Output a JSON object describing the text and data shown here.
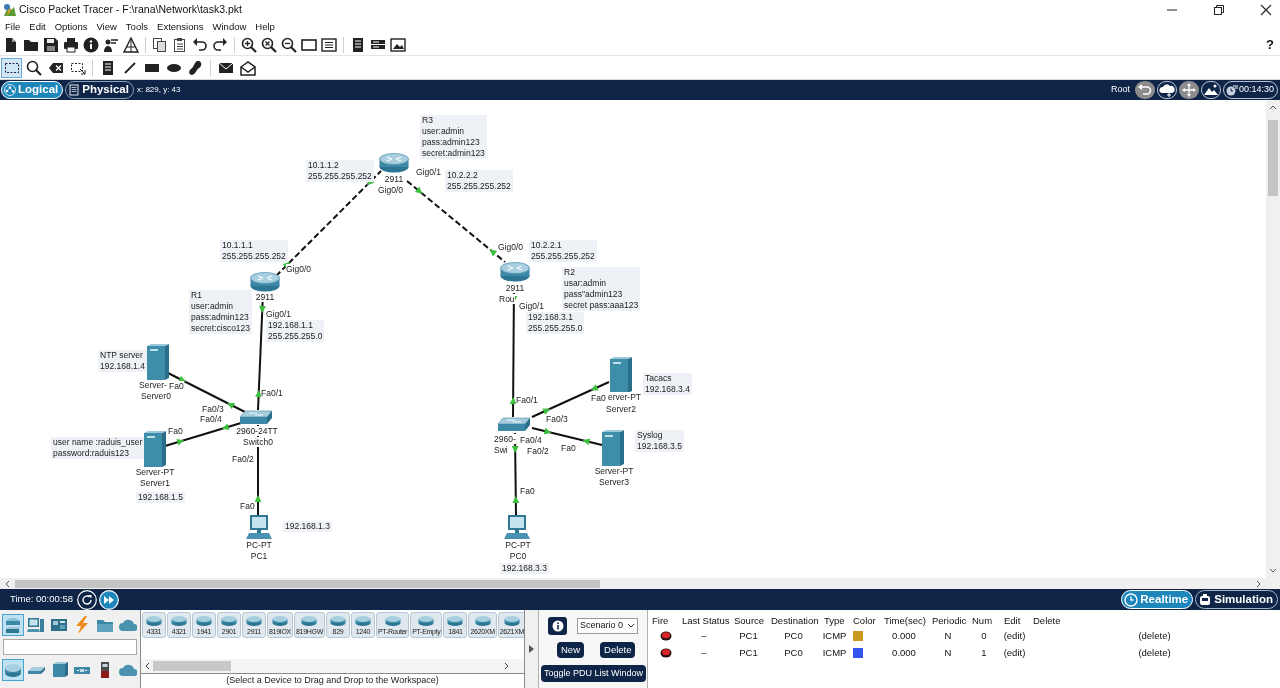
{
  "window": {
    "title": "Cisco Packet Tracer - F:\\rana\\Network\\task3.pkt"
  },
  "menu": [
    "File",
    "Edit",
    "Options",
    "View",
    "Tools",
    "Extensions",
    "Window",
    "Help"
  ],
  "help_button": "?",
  "edit_tools": [
    {
      "selected": true
    },
    {
      "selected": false
    },
    {
      "selected": false
    },
    {
      "selected": false
    },
    {
      "selected": false
    },
    {
      "selected": false
    },
    {
      "selected": false
    },
    {
      "selected": false
    },
    {
      "selected": false
    },
    {
      "selected": false
    },
    {
      "selected": false
    }
  ],
  "view_bar": {
    "tabs": [
      {
        "label": "Logical",
        "selected": true
      },
      {
        "label": "Physical",
        "selected": false
      }
    ],
    "pointer": "x: 829, y: 43",
    "location": "Root",
    "clock": "00:14:30"
  },
  "workspace": {
    "notes": [
      {
        "lines": [
          "R3",
          "user:admin",
          "pass:admin123",
          "secret:admin123"
        ]
      },
      {
        "lines": [
          "10.1.1.2",
          "255.255.255.252"
        ]
      },
      {
        "lines": [
          "10.2.2.2",
          "255.255.255.252"
        ]
      },
      {
        "lines": [
          "10.1.1.1",
          "255.255.255.252"
        ]
      },
      {
        "lines": [
          "10.2.2.1",
          "255.255.255.252"
        ]
      },
      {
        "lines": [
          "R2",
          "usar:admin",
          "pass\"admin123",
          "secret pass:aaa123"
        ]
      },
      {
        "lines": [
          "R1",
          "user:admin",
          "pass:admin123",
          "secret:cisco123"
        ]
      },
      {
        "lines": [
          "192.168.3.1",
          "255.255.255.0"
        ]
      },
      {
        "lines": [
          "192.168.1.1",
          "255.255.255.0"
        ]
      },
      {
        "lines": [
          "NTP server",
          "192.168.1.4"
        ]
      },
      {
        "lines": [
          "Tacacs",
          "192.168.3.4"
        ]
      },
      {
        "lines": [
          "Syslog",
          "192.168.3.5"
        ]
      },
      {
        "lines": [
          "user name :raduis_user",
          "password:raduis123"
        ]
      },
      {
        "lines": [
          "192.168.1.5"
        ]
      },
      {
        "lines": [
          "192.168.1.3"
        ]
      },
      {
        "lines": [
          "192.168.3.3"
        ]
      }
    ],
    "devices": [
      {
        "kind": "router",
        "labels": [
          "2911"
        ]
      },
      {
        "kind": "router",
        "labels": [
          "2911"
        ]
      },
      {
        "kind": "router",
        "labels": [
          "2911",
          "Rou"
        ]
      },
      {
        "kind": "switch",
        "labels": [
          "2960-24TT",
          "Switch0"
        ]
      },
      {
        "kind": "switch",
        "labels": [
          "2960-",
          "Swi"
        ]
      },
      {
        "kind": "server",
        "labels": [
          "Server-",
          "Server0"
        ]
      },
      {
        "kind": "server",
        "labels": [
          "Server-PT",
          "Server1"
        ]
      },
      {
        "kind": "server",
        "labels": [
          "erver-PT",
          "Server2"
        ]
      },
      {
        "kind": "server",
        "labels": [
          "Server-PT",
          "Server3"
        ]
      },
      {
        "kind": "pc",
        "labels": [
          "PC-PT",
          "PC1"
        ]
      },
      {
        "kind": "pc",
        "labels": [
          "PC-PT",
          "PC0"
        ]
      }
    ],
    "links": [
      {
        "kind": "crossover",
        "ports": [
          "Gig0/0",
          "Gig0/0"
        ]
      },
      {
        "kind": "crossover",
        "ports": [
          "Gig0/1",
          "Gig0/0"
        ]
      },
      {
        "kind": "straight",
        "ports": [
          "Gig0/1",
          "Fa0/1"
        ]
      },
      {
        "kind": "straight",
        "ports": [
          "Fa0",
          "Fa0/3"
        ]
      },
      {
        "kind": "straight",
        "ports": [
          "Fa0/4",
          "Fa0"
        ]
      },
      {
        "kind": "straight",
        "ports": [
          "Fa0/2",
          "Fa0"
        ]
      },
      {
        "kind": "straight",
        "ports": [
          "Gig0/1",
          "Fa0/1"
        ]
      },
      {
        "kind": "straight",
        "ports": [
          "Fa0",
          "Fa0/3"
        ]
      },
      {
        "kind": "straight",
        "ports": [
          "Fa0/4",
          "Fa0"
        ]
      },
      {
        "kind": "straight",
        "ports": [
          "Fa0/2",
          "Fa0"
        ]
      }
    ]
  },
  "time_bar": {
    "time": "Time: 00:00:58",
    "modes": [
      {
        "label": "Realtime",
        "selected": true
      },
      {
        "label": "Simulation",
        "selected": false
      }
    ]
  },
  "device_palette": {
    "categories": [
      {
        "selected": true
      },
      {
        "selected": false
      },
      {
        "selected": false
      },
      {
        "selected": false
      },
      {
        "selected": false
      },
      {
        "selected": false
      }
    ],
    "types": [
      {
        "selected": true
      },
      {
        "selected": false
      },
      {
        "selected": false
      },
      {
        "selected": false
      },
      {
        "selected": false
      },
      {
        "selected": false
      }
    ],
    "models": [
      "4331",
      "4321",
      "1941",
      "2901",
      "2911",
      "819IOX",
      "819HGW",
      "829",
      "1240",
      "PT-Router",
      "PT-Empty",
      "1841",
      "2620XM",
      "2621XM"
    ],
    "hint": "(Select a Device to Drag and Drop to the Workspace)"
  },
  "scenario": {
    "selected": "Scenario 0",
    "buttons": [
      "New",
      "Delete"
    ],
    "toggle_button": "Toggle PDU List Window"
  },
  "pdu_list": {
    "columns": [
      "Fire",
      "Last Status",
      "Source",
      "Destination",
      "Type",
      "Color",
      "Time(sec)",
      "Periodic",
      "Num",
      "Edit",
      "Delete"
    ],
    "rows": [
      {
        "last_status": "–",
        "source": "PC1",
        "destination": "PC0",
        "type": "ICMP",
        "color": "#c99a1d",
        "time": "0.000",
        "periodic": "N",
        "num": "0",
        "edit": "(edit)",
        "delete": "(delete)"
      },
      {
        "last_status": "–",
        "source": "PC1",
        "destination": "PC0",
        "type": "ICMP",
        "color": "#3355ee",
        "time": "0.000",
        "periodic": "N",
        "num": "1",
        "edit": "(edit)",
        "delete": "(delete)"
      }
    ]
  }
}
